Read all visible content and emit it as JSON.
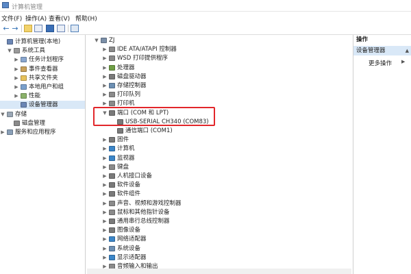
{
  "window": {
    "title": "计算机管理"
  },
  "menu": [
    "文件(F)",
    "操作(A)",
    "查看(V)",
    "帮助(H)"
  ],
  "left_tree": [
    {
      "label": "计算机管理(本地)",
      "depth": 0,
      "chev": "",
      "icon": "computer-management-icon",
      "color": "#6b86b5"
    },
    {
      "label": "系统工具",
      "depth": 1,
      "chev": "v",
      "icon": "tools-icon",
      "color": "#9a9a9a"
    },
    {
      "label": "任务计划程序",
      "depth": 2,
      "chev": ">",
      "icon": "task-scheduler-icon",
      "color": "#8aa7cf"
    },
    {
      "label": "事件查看器",
      "depth": 2,
      "chev": ">",
      "icon": "event-viewer-icon",
      "color": "#c9a15a"
    },
    {
      "label": "共享文件夹",
      "depth": 2,
      "chev": ">",
      "icon": "shared-folder-icon",
      "color": "#e7c25c"
    },
    {
      "label": "本地用户和组",
      "depth": 2,
      "chev": ">",
      "icon": "users-icon",
      "color": "#7aa0cc"
    },
    {
      "label": "性能",
      "depth": 2,
      "chev": ">",
      "icon": "performance-icon",
      "color": "#8bb26a"
    },
    {
      "label": "设备管理器",
      "depth": 2,
      "chev": "",
      "icon": "device-manager-icon",
      "color": "#6b86b5",
      "selected": true
    },
    {
      "label": "存储",
      "depth": 0,
      "chev": "v",
      "icon": "storage-icon",
      "color": "#9aa7b5"
    },
    {
      "label": "磁盘管理",
      "depth": 1,
      "chev": "",
      "icon": "disk-icon",
      "color": "#8a8a8a"
    },
    {
      "label": "服务和应用程序",
      "depth": 0,
      "chev": ">",
      "icon": "services-icon",
      "color": "#8aa0b8"
    }
  ],
  "device_tree": [
    {
      "label": "ZJ",
      "depth": 0,
      "chev": "v",
      "icon": "computer-icon",
      "color": "#7b8fa8"
    },
    {
      "label": "IDE ATA/ATAPI 控制器",
      "depth": 1,
      "chev": ">",
      "icon": "ide-controller-icon",
      "color": "#8a8a8a"
    },
    {
      "label": "WSD 打印提供程序",
      "depth": 1,
      "chev": ">",
      "icon": "printer-icon",
      "color": "#8a8a8a"
    },
    {
      "label": "处理器",
      "depth": 1,
      "chev": ">",
      "icon": "processor-icon",
      "color": "#6f9f45"
    },
    {
      "label": "磁盘驱动器",
      "depth": 1,
      "chev": ">",
      "icon": "disk-drive-icon",
      "color": "#7a7a7a"
    },
    {
      "label": "存储控制器",
      "depth": 1,
      "chev": ">",
      "icon": "storage-controller-icon",
      "color": "#6c8fb3"
    },
    {
      "label": "打印队列",
      "depth": 1,
      "chev": ">",
      "icon": "print-queue-icon",
      "color": "#8a8a8a"
    },
    {
      "label": "打印机",
      "depth": 1,
      "chev": ">",
      "icon": "printer-icon",
      "color": "#8a8a8a"
    },
    {
      "label": "端口 (COM 和 LPT)",
      "depth": 1,
      "chev": "v",
      "icon": "port-icon",
      "color": "#7a7a7a"
    },
    {
      "label": "USB-SERIAL CH340 (COM83)",
      "depth": 2,
      "chev": "",
      "icon": "port-icon",
      "color": "#7a7a7a"
    },
    {
      "label": "通信端口 (COM1)",
      "depth": 2,
      "chev": "",
      "icon": "port-icon",
      "color": "#7a7a7a"
    },
    {
      "label": "固件",
      "depth": 1,
      "chev": ">",
      "icon": "firmware-icon",
      "color": "#7a7a7a"
    },
    {
      "label": "计算机",
      "depth": 1,
      "chev": ">",
      "icon": "computer-icon",
      "color": "#3b86c9"
    },
    {
      "label": "监视器",
      "depth": 1,
      "chev": ">",
      "icon": "monitor-icon",
      "color": "#3b86c9"
    },
    {
      "label": "键盘",
      "depth": 1,
      "chev": ">",
      "icon": "keyboard-icon",
      "color": "#8a8a8a"
    },
    {
      "label": "人机接口设备",
      "depth": 1,
      "chev": ">",
      "icon": "hid-icon",
      "color": "#7a7a7a"
    },
    {
      "label": "软件设备",
      "depth": 1,
      "chev": ">",
      "icon": "software-device-icon",
      "color": "#7a7a7a"
    },
    {
      "label": "软件组件",
      "depth": 1,
      "chev": ">",
      "icon": "software-component-icon",
      "color": "#7a7a7a"
    },
    {
      "label": "声音、视频和游戏控制器",
      "depth": 1,
      "chev": ">",
      "icon": "sound-icon",
      "color": "#8a8a8a"
    },
    {
      "label": "鼠标和其他指针设备",
      "depth": 1,
      "chev": ">",
      "icon": "mouse-icon",
      "color": "#8a8a8a"
    },
    {
      "label": "通用串行总线控制器",
      "depth": 1,
      "chev": ">",
      "icon": "usb-icon",
      "color": "#7a7a7a"
    },
    {
      "label": "图像设备",
      "depth": 1,
      "chev": ">",
      "icon": "camera-icon",
      "color": "#7a7a7a"
    },
    {
      "label": "网络适配器",
      "depth": 1,
      "chev": ">",
      "icon": "network-icon",
      "color": "#3b86c9"
    },
    {
      "label": "系统设备",
      "depth": 1,
      "chev": ">",
      "icon": "system-device-icon",
      "color": "#6c8fb3"
    },
    {
      "label": "显示适配器",
      "depth": 1,
      "chev": ">",
      "icon": "display-adapter-icon",
      "color": "#3b86c9"
    },
    {
      "label": "音频输入和输出",
      "depth": 1,
      "chev": ">",
      "icon": "audio-icon",
      "color": "#8a8a8a"
    }
  ],
  "actions": {
    "header": "操作",
    "selected": "设备管理器",
    "more": "更多操作"
  },
  "colors": {
    "highlight": "#e2262a",
    "selection": "#d9e8f7"
  }
}
